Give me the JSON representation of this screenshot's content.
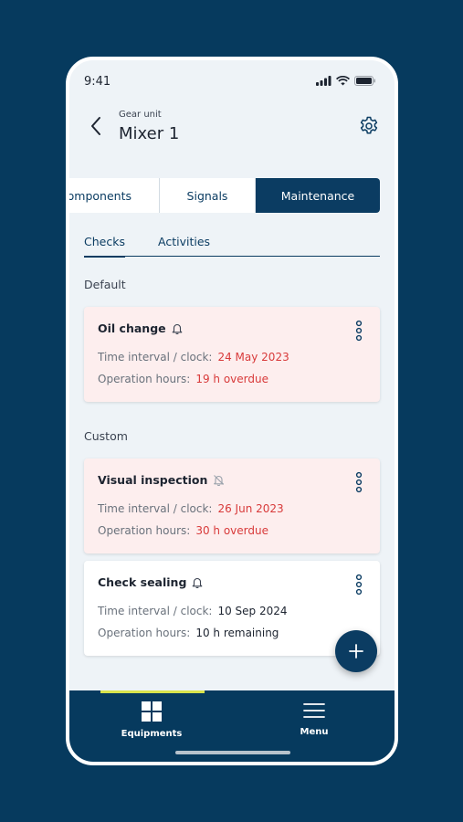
{
  "status": {
    "time": "9:41"
  },
  "header": {
    "subtitle": "Gear unit",
    "title": "Mixer 1"
  },
  "segment_tabs": [
    {
      "label": "omponents",
      "active": false
    },
    {
      "label": "Signals",
      "active": false
    },
    {
      "label": "Maintenance",
      "active": true
    }
  ],
  "sub_tabs": [
    {
      "label": "Checks",
      "active": true
    },
    {
      "label": "Activities",
      "active": false
    }
  ],
  "sections": {
    "default": "Default",
    "custom": "Custom"
  },
  "checks": [
    {
      "title": "Oil change",
      "bell": "bell-icon",
      "time_label": "Time interval / clock:",
      "time_value": "24 May 2023",
      "hours_label": "Operation hours:",
      "hours_value": "19 h overdue",
      "status": "overdue"
    },
    {
      "title": "Visual inspection",
      "bell": "bell-off-icon",
      "time_label": "Time interval / clock:",
      "time_value": "26 Jun 2023",
      "hours_label": "Operation hours:",
      "hours_value": "30 h overdue",
      "status": "overdue"
    },
    {
      "title": "Check sealing",
      "bell": "bell-icon",
      "time_label": "Time interval / clock:",
      "time_value": "10 Sep 2024",
      "hours_label": "Operation hours:",
      "hours_value": "10 h remaining",
      "status": "ok"
    }
  ],
  "bottom_nav": [
    {
      "label": "Equipments",
      "icon": "grid-icon",
      "active": true
    },
    {
      "label": "Menu",
      "icon": "hamburger-icon",
      "active": false
    }
  ],
  "colors": {
    "brand": "#0b3c62",
    "overdue": "#d83a3a",
    "accent": "#d7e34c",
    "alert_bg": "#fdeeee"
  }
}
